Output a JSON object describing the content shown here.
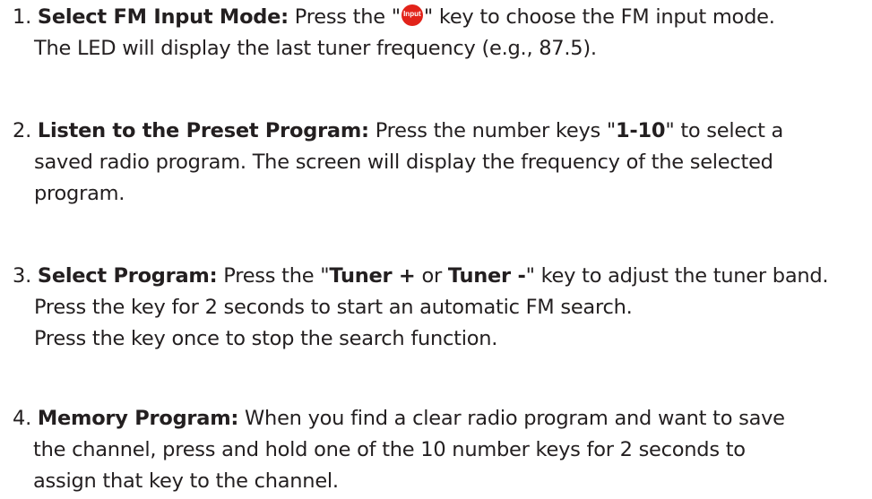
{
  "items": [
    {
      "num": "1.",
      "title": "Select FM Input Mode:",
      "text_a": " Press the \"",
      "icon_label": "Input",
      "text_b": "\" key to choose the FM input mode.",
      "line2": "The LED will display the last tuner frequency (e.g., 87.5)."
    },
    {
      "num": "2.",
      "title": "Listen to the Preset Program:",
      "text_a": " Press the number keys \"",
      "keys": "1-10",
      "text_b": "\" to select a",
      "line2": "saved radio program. The screen will display the frequency of the selected",
      "line3": "program."
    },
    {
      "num": "3.",
      "title": "Select Program:",
      "text_a": " Press the \"",
      "key_a": "Tuner +",
      "text_b": " or ",
      "key_b": "Tuner -",
      "text_c": "\" key to adjust the tuner band.",
      "line2": "Press the key for 2 seconds to start an automatic FM search.",
      "line3": "Press the key once to stop the search function."
    },
    {
      "num": "4.",
      "title": "Memory Program:",
      "text_a": " When you find a clear radio program and want to save",
      "line2": "the channel, press and hold one of the 10 number keys for 2 seconds to",
      "line3": "assign that key to the channel."
    }
  ],
  "colors": {
    "text": "#231f20",
    "input_icon": "#e2231a"
  },
  "icons": {
    "input_key": "input-key-icon"
  }
}
